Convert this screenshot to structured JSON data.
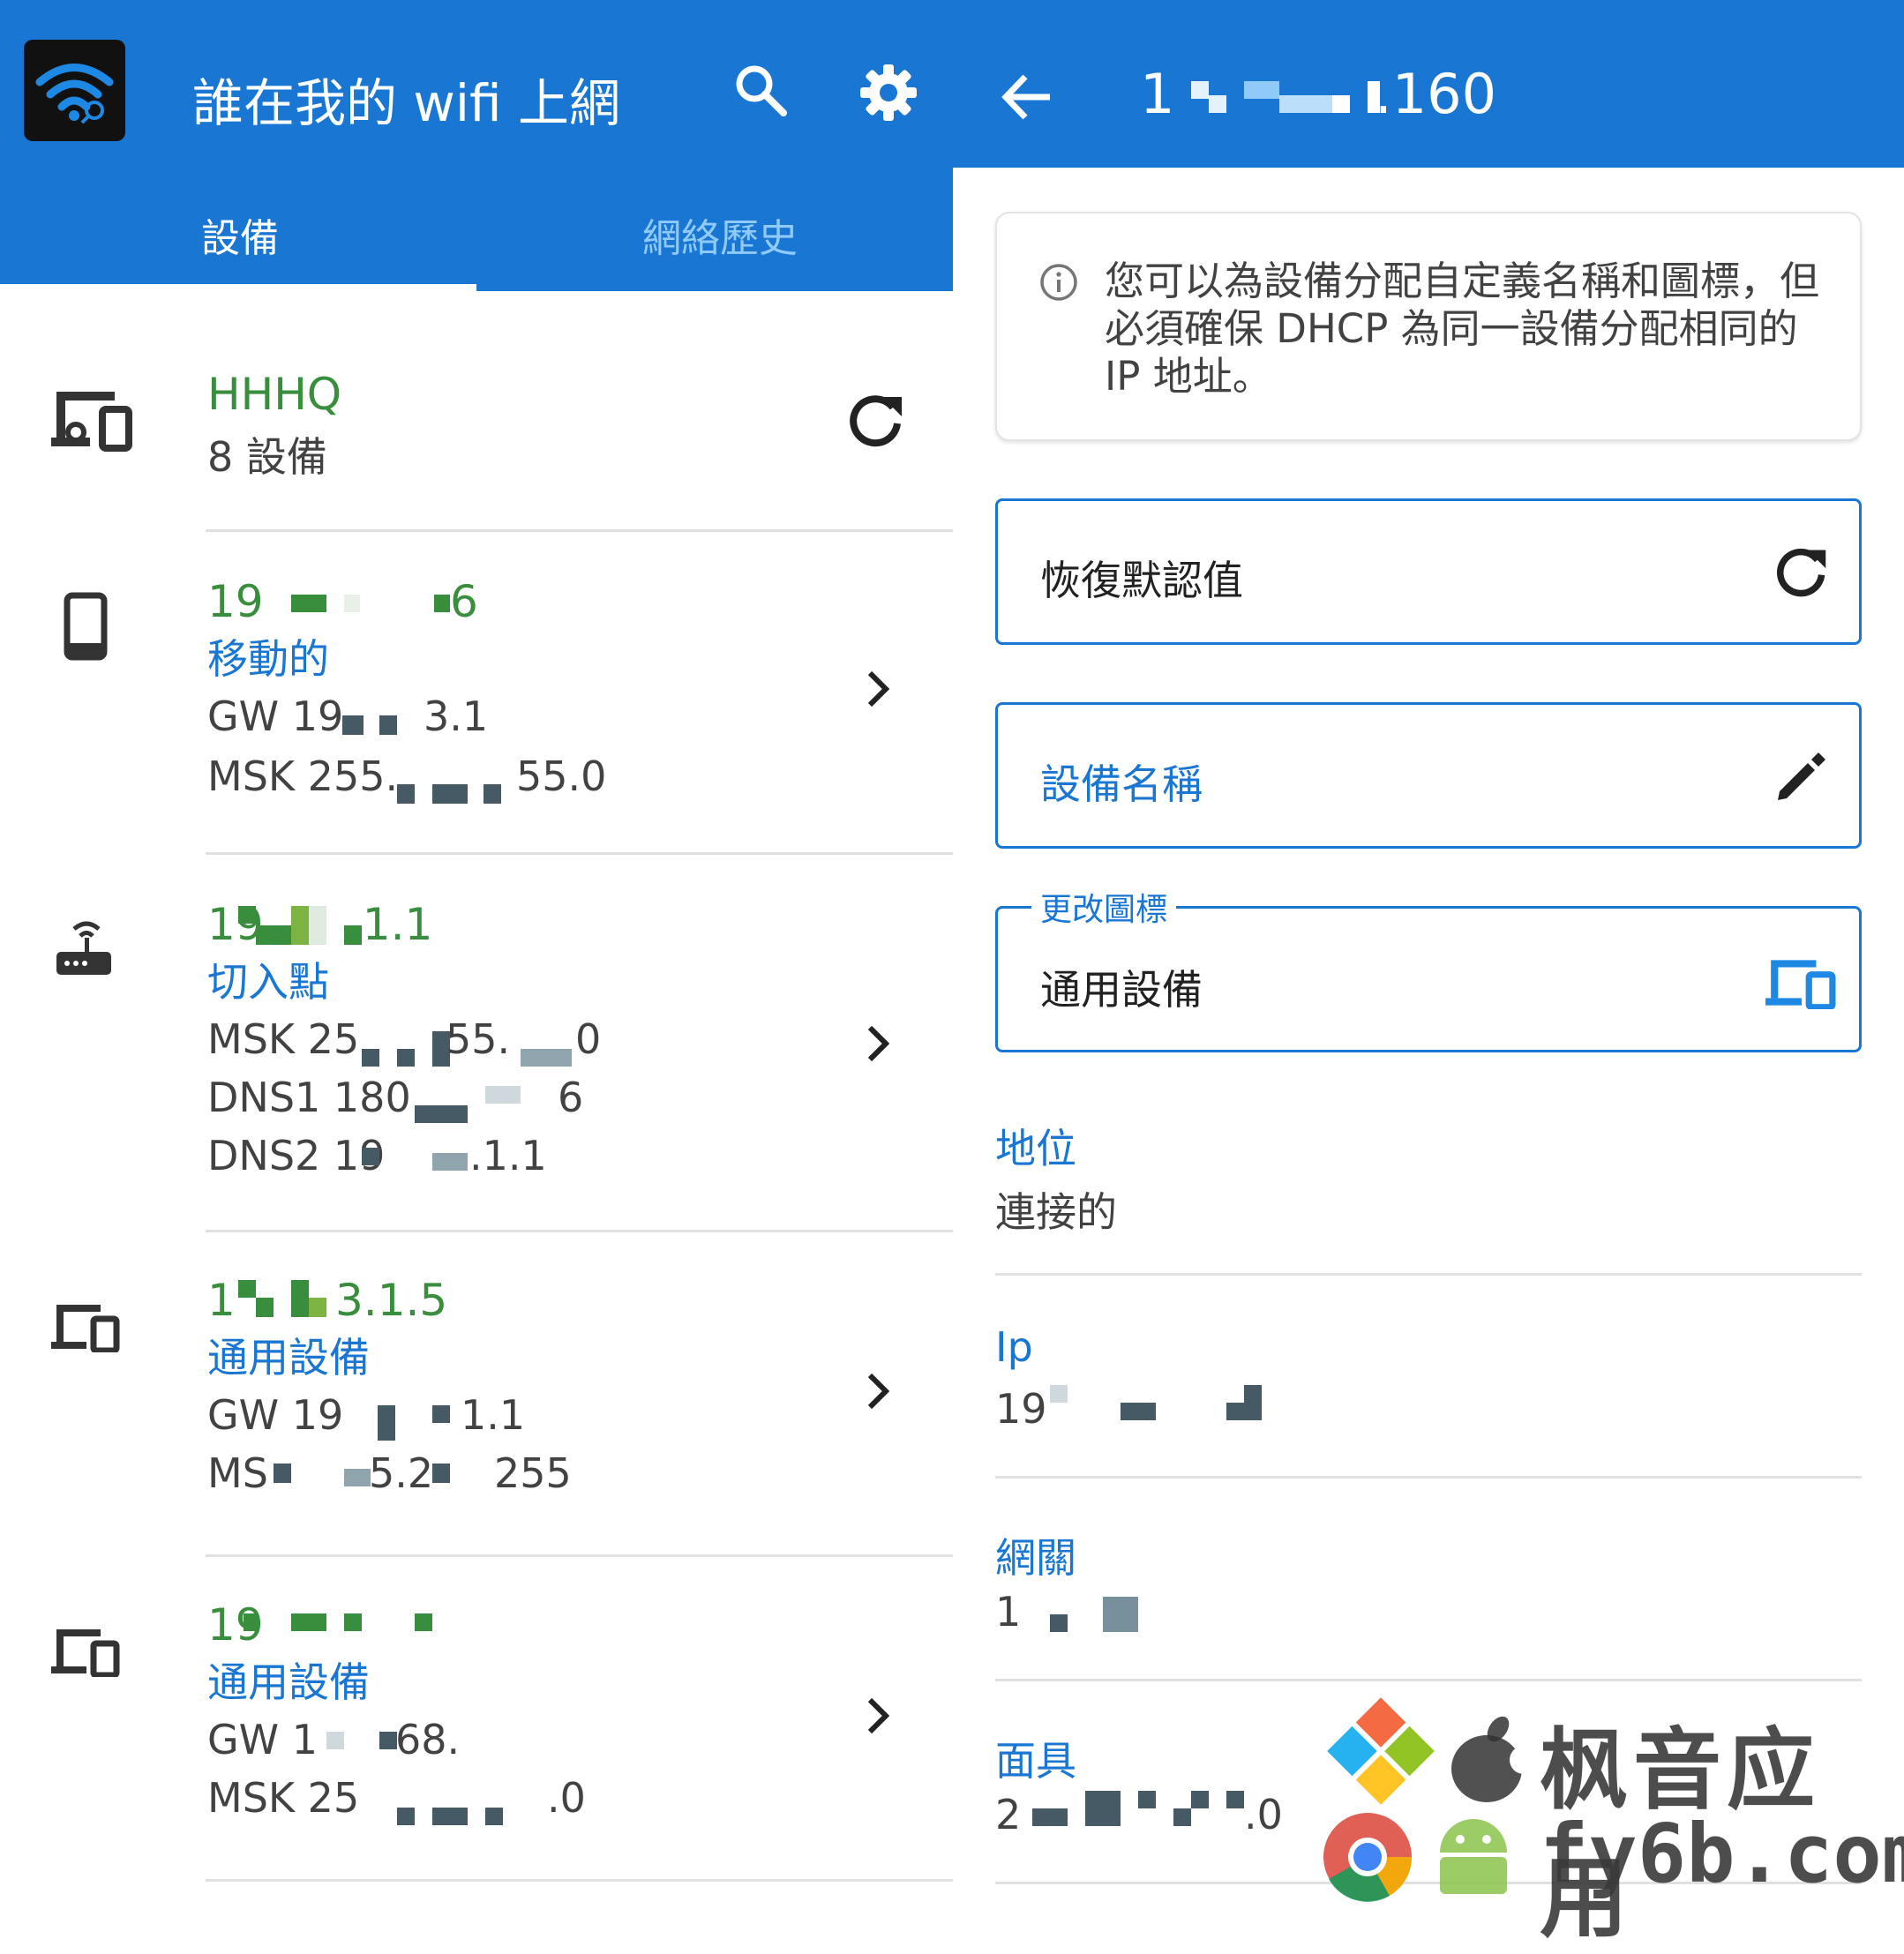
{
  "left": {
    "app_title": "誰在我的 wifi 上網",
    "tabs": [
      "設備",
      "網絡歷史"
    ],
    "network": {
      "name": "HHHQ",
      "count": "8 設備"
    },
    "devices": [
      {
        "ip": "19",
        "type": "移動的",
        "lines": [
          "GW 19",
          "MSK 255."
        ]
      },
      {
        "ip": "19",
        "type": "切入點",
        "lines": [
          "MSK 25",
          "DNS1 180",
          "DNS2 19"
        ]
      },
      {
        "ip": "1",
        "type": "通用設備",
        "lines": [
          "GW 19",
          "MS"
        ]
      },
      {
        "ip": "19",
        "type": "通用設備",
        "lines": [
          "GW 1",
          "MSK 25"
        ]
      }
    ],
    "fragments": {
      "d1_ip_end": "6",
      "d1_gw_end": "3.1",
      "d1_msk_end": "55.0",
      "d2_ip_end": ".1.1",
      "d2_msk_mid": "55.",
      "d2_msk_end": "0",
      "d2_dns1_end": "6",
      "d2_dns2_end": ".1.1",
      "d3_ip_end": "3.1.5",
      "d3_gw_end": "1.1",
      "d3_msk_mid": "5.2",
      "d3_msk_end": "255",
      "d4_gw_mid": "68.",
      "d4_msk_end": ".0"
    }
  },
  "right": {
    "header_ip_start": "1",
    "header_ip_end": ".160",
    "info_text": "您可以為設備分配自定義名稱和圖標，但必須確保 DHCP 為同一設備分配相同的 IP 地址。",
    "restore_label": "恢復默認值",
    "device_name_placeholder": "設備名稱",
    "icon_field_label": "更改圖標",
    "icon_field_value": "通用設備",
    "status_label": "地位",
    "status_value": "連接的",
    "ip_label": "Ip",
    "ip_value": "19",
    "gateway_label": "網關",
    "gateway_value": "1",
    "mask_label": "面具",
    "mask_value": "2",
    "mask_end": ".0"
  },
  "watermark": {
    "text_cn": "枫音应用",
    "text_url": "fy6b.com"
  },
  "colors": {
    "primary": "#1976d2",
    "green": "#388e3c",
    "text": "#424242"
  }
}
